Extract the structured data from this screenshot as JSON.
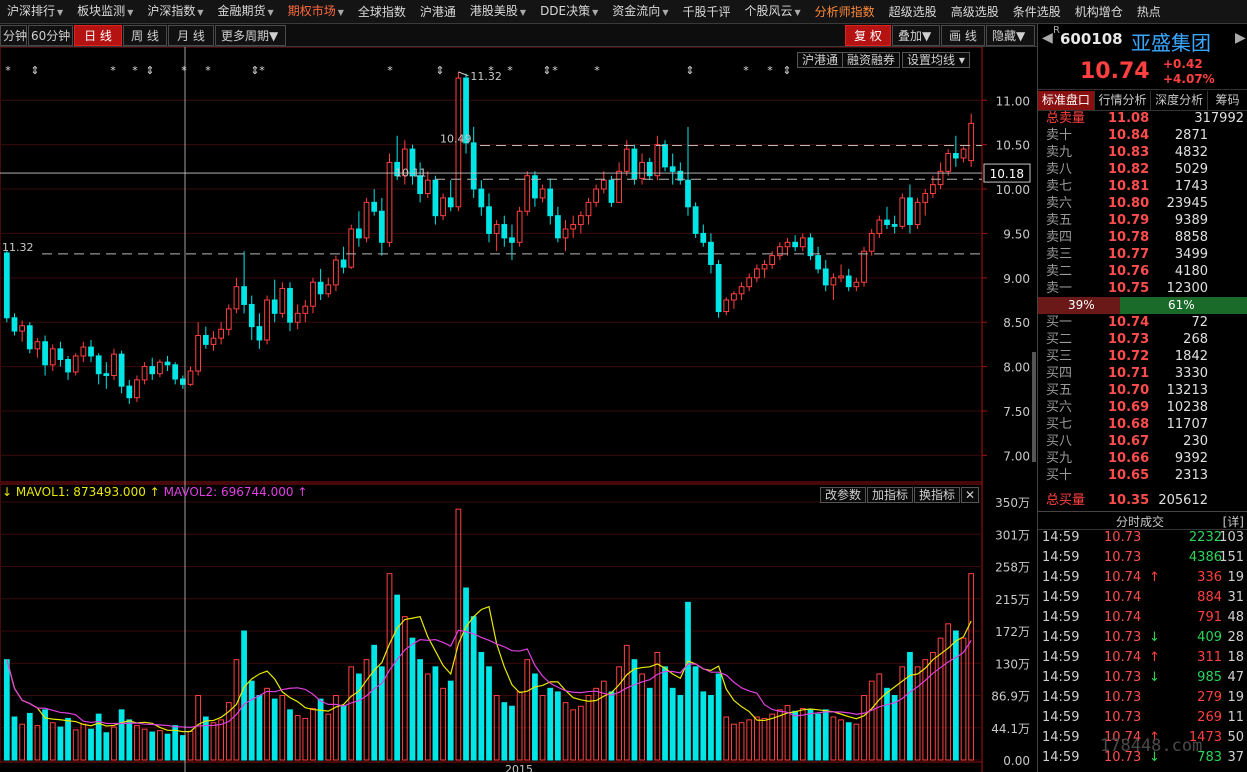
{
  "menu": [
    {
      "label": "沪深排行",
      "dd": true
    },
    {
      "label": "板块监测",
      "dd": true
    },
    {
      "label": "沪深指数",
      "dd": true
    },
    {
      "label": "金融期货",
      "dd": true
    },
    {
      "label": "期权市场",
      "dd": true,
      "active": true
    },
    {
      "label": "全球指数",
      "dd": false
    },
    {
      "label": "沪港通",
      "dd": false
    },
    {
      "label": "港股美股",
      "dd": true
    },
    {
      "label": "DDE决策",
      "dd": true
    },
    {
      "label": "资金流向",
      "dd": true
    },
    {
      "label": "千股千评",
      "dd": false
    },
    {
      "label": "个股风云",
      "dd": true
    },
    {
      "label": "分析师指数",
      "dd": false,
      "orange": true
    },
    {
      "label": "超级选股",
      "dd": false
    },
    {
      "label": "高级选股",
      "dd": false
    },
    {
      "label": "条件选股",
      "dd": false
    },
    {
      "label": "机构增仓",
      "dd": false
    },
    {
      "label": "热点",
      "dd": false
    }
  ],
  "toolbar": {
    "periods": [
      "分钟",
      "60分钟",
      "日 线",
      "周 线",
      "月 线"
    ],
    "more": "更多周期",
    "selected": "日 线",
    "restore": "复 权",
    "overlay": "叠加",
    "draw": "画 线",
    "hide": "隐藏"
  },
  "chart_buttons": {
    "hgt": "沪港通",
    "rzrq": "融资融券",
    "ma_settings": "设置均线"
  },
  "vol_buttons": {
    "change": "改参数",
    "add": "加指标",
    "swap": "换指标"
  },
  "legend": {
    "arrow": "↓",
    "mavol1": "MAVOL1: 873493.000",
    "mavol2": "MAVOL2: 696744.000",
    "up": "↑"
  },
  "colors": {
    "up": "#ff4040",
    "down": "#00e6e6",
    "ma1": "#e8e800",
    "ma2": "#e040e0",
    "text": "#c8c8c8",
    "grid": "#8c1010"
  },
  "price_ticks": [
    "11.00",
    "10.50",
    "10.00",
    "9.50",
    "9.00",
    "8.50",
    "8.00",
    "7.50",
    "7.00"
  ],
  "current_price_label": "10.18",
  "price_annotations": [
    "11.32",
    "10.49",
    "10.11",
    "9.27"
  ],
  "volume_ticks": [
    "350万",
    "301万",
    "258万",
    "215万",
    "172万",
    "130万",
    "86.9万",
    "44.1万",
    "0.00"
  ],
  "x_label": "2015",
  "chart_data": {
    "type": "candlestick",
    "xlabel": "2015",
    "ylim": [
      6.7,
      11.6
    ],
    "volume_ylim": [
      0,
      3600000
    ],
    "ma_volume": {
      "mavol1": 873493.0,
      "mavol2": 696744.0
    },
    "candles": [
      [
        9.28,
        9.3,
        8.5,
        8.55,
        1400000
      ],
      [
        8.55,
        8.6,
        8.35,
        8.4,
        600000
      ],
      [
        8.4,
        8.52,
        8.28,
        8.46,
        500000
      ],
      [
        8.46,
        8.5,
        8.15,
        8.2,
        650000
      ],
      [
        8.2,
        8.32,
        8.1,
        8.28,
        480000
      ],
      [
        8.28,
        8.35,
        7.9,
        8.02,
        700000
      ],
      [
        8.02,
        8.25,
        7.95,
        8.2,
        520000
      ],
      [
        8.2,
        8.28,
        8.0,
        8.08,
        460000
      ],
      [
        8.08,
        8.12,
        7.85,
        7.94,
        580000
      ],
      [
        7.94,
        8.15,
        7.9,
        8.12,
        420000
      ],
      [
        8.12,
        8.28,
        8.05,
        8.22,
        500000
      ],
      [
        8.22,
        8.3,
        8.05,
        8.12,
        430000
      ],
      [
        8.12,
        8.15,
        7.8,
        7.92,
        640000
      ],
      [
        7.92,
        8.05,
        7.75,
        7.9,
        380000
      ],
      [
        7.9,
        8.2,
        7.85,
        8.14,
        460000
      ],
      [
        8.14,
        8.18,
        7.7,
        7.78,
        700000
      ],
      [
        7.78,
        7.85,
        7.58,
        7.65,
        560000
      ],
      [
        7.65,
        7.9,
        7.6,
        7.85,
        480000
      ],
      [
        7.85,
        8.05,
        7.8,
        8.0,
        430000
      ],
      [
        8.0,
        8.1,
        7.85,
        7.92,
        390000
      ],
      [
        7.92,
        8.08,
        7.88,
        8.05,
        410000
      ],
      [
        8.05,
        8.12,
        7.95,
        8.02,
        360000
      ],
      [
        8.02,
        8.05,
        7.8,
        7.86,
        480000
      ],
      [
        7.86,
        7.9,
        7.75,
        7.8,
        340000
      ],
      [
        7.8,
        8.0,
        7.78,
        7.95,
        400000
      ],
      [
        7.95,
        8.5,
        7.9,
        8.35,
        900000
      ],
      [
        8.35,
        8.45,
        8.2,
        8.25,
        600000
      ],
      [
        8.25,
        8.4,
        8.18,
        8.32,
        520000
      ],
      [
        8.32,
        8.5,
        8.25,
        8.42,
        560000
      ],
      [
        8.42,
        8.7,
        8.35,
        8.65,
        800000
      ],
      [
        8.65,
        9.0,
        8.6,
        8.9,
        1400000
      ],
      [
        8.9,
        9.3,
        8.6,
        8.7,
        1800000
      ],
      [
        8.7,
        8.8,
        8.3,
        8.45,
        1100000
      ],
      [
        8.45,
        8.6,
        8.2,
        8.3,
        900000
      ],
      [
        8.3,
        8.8,
        8.25,
        8.75,
        1000000
      ],
      [
        8.75,
        8.98,
        8.5,
        8.6,
        850000
      ],
      [
        8.6,
        8.95,
        8.55,
        8.88,
        900000
      ],
      [
        8.88,
        8.95,
        8.4,
        8.5,
        700000
      ],
      [
        8.5,
        8.7,
        8.42,
        8.6,
        620000
      ],
      [
        8.6,
        8.75,
        8.5,
        8.68,
        580000
      ],
      [
        8.68,
        9.0,
        8.6,
        8.95,
        720000
      ],
      [
        8.95,
        9.1,
        8.75,
        8.82,
        850000
      ],
      [
        8.82,
        9.0,
        8.78,
        8.92,
        640000
      ],
      [
        8.92,
        9.25,
        8.85,
        9.2,
        900000
      ],
      [
        9.2,
        9.35,
        9.05,
        9.12,
        760000
      ],
      [
        9.12,
        9.6,
        9.1,
        9.55,
        1300000
      ],
      [
        9.55,
        9.75,
        9.35,
        9.45,
        1200000
      ],
      [
        9.45,
        9.9,
        9.4,
        9.85,
        1400000
      ],
      [
        9.85,
        10.0,
        9.7,
        9.75,
        1600000
      ],
      [
        9.75,
        9.9,
        9.25,
        9.4,
        1300000
      ],
      [
        9.4,
        10.4,
        9.35,
        10.3,
        2600000
      ],
      [
        10.3,
        10.6,
        10.1,
        10.15,
        2300000
      ],
      [
        10.15,
        10.55,
        10.05,
        10.45,
        2000000
      ],
      [
        10.45,
        10.5,
        10.05,
        10.15,
        1700000
      ],
      [
        10.15,
        10.3,
        9.85,
        9.95,
        1400000
      ],
      [
        9.95,
        10.2,
        9.9,
        10.1,
        1200000
      ],
      [
        10.1,
        10.15,
        9.6,
        9.7,
        1300000
      ],
      [
        9.7,
        9.95,
        9.65,
        9.9,
        1000000
      ],
      [
        9.9,
        10.1,
        9.75,
        9.8,
        1100000
      ],
      [
        9.8,
        11.32,
        9.75,
        11.25,
        3500000
      ],
      [
        11.25,
        11.3,
        10.4,
        10.52,
        2400000
      ],
      [
        10.52,
        10.7,
        9.9,
        10.0,
        2000000
      ],
      [
        10.0,
        10.1,
        9.7,
        9.8,
        1500000
      ],
      [
        9.8,
        9.95,
        9.4,
        9.5,
        1300000
      ],
      [
        9.5,
        9.65,
        9.3,
        9.6,
        900000
      ],
      [
        9.6,
        9.7,
        9.35,
        9.45,
        800000
      ],
      [
        9.45,
        9.6,
        9.2,
        9.4,
        750000
      ],
      [
        9.4,
        9.8,
        9.35,
        9.75,
        950000
      ],
      [
        9.75,
        10.2,
        9.7,
        10.15,
        1400000
      ],
      [
        10.15,
        10.2,
        9.8,
        9.9,
        1200000
      ],
      [
        9.9,
        10.05,
        9.85,
        10.0,
        900000
      ],
      [
        10.0,
        10.12,
        9.6,
        9.7,
        1000000
      ],
      [
        9.7,
        9.8,
        9.4,
        9.45,
        950000
      ],
      [
        9.45,
        9.65,
        9.3,
        9.55,
        800000
      ],
      [
        9.55,
        9.7,
        9.45,
        9.6,
        700000
      ],
      [
        9.6,
        9.75,
        9.5,
        9.7,
        750000
      ],
      [
        9.7,
        9.9,
        9.6,
        9.85,
        900000
      ],
      [
        9.85,
        10.05,
        9.8,
        10.0,
        1000000
      ],
      [
        10.0,
        10.2,
        9.95,
        10.1,
        1100000
      ],
      [
        10.1,
        10.15,
        9.8,
        9.85,
        950000
      ],
      [
        9.85,
        10.3,
        9.85,
        10.2,
        1300000
      ],
      [
        10.2,
        10.55,
        10.15,
        10.45,
        1600000
      ],
      [
        10.45,
        10.5,
        10.05,
        10.12,
        1400000
      ],
      [
        10.12,
        10.4,
        10.05,
        10.3,
        1200000
      ],
      [
        10.3,
        10.35,
        10.1,
        10.15,
        1000000
      ],
      [
        10.15,
        10.6,
        10.1,
        10.5,
        1500000
      ],
      [
        10.5,
        10.55,
        10.2,
        10.25,
        1300000
      ],
      [
        10.25,
        10.4,
        10.05,
        10.2,
        1000000
      ],
      [
        10.2,
        10.3,
        10.05,
        10.1,
        900000
      ],
      [
        10.1,
        10.7,
        9.7,
        9.8,
        2200000
      ],
      [
        9.8,
        9.85,
        9.45,
        9.5,
        1300000
      ],
      [
        9.5,
        9.6,
        9.35,
        9.4,
        950000
      ],
      [
        9.4,
        9.5,
        9.05,
        9.15,
        900000
      ],
      [
        9.15,
        9.2,
        8.55,
        8.62,
        1200000
      ],
      [
        8.62,
        8.78,
        8.58,
        8.75,
        600000
      ],
      [
        8.75,
        8.85,
        8.65,
        8.82,
        500000
      ],
      [
        8.82,
        8.95,
        8.75,
        8.9,
        520000
      ],
      [
        8.9,
        9.05,
        8.85,
        9.0,
        560000
      ],
      [
        9.0,
        9.15,
        8.95,
        9.1,
        600000
      ],
      [
        9.1,
        9.2,
        9.0,
        9.15,
        580000
      ],
      [
        9.15,
        9.3,
        9.1,
        9.25,
        640000
      ],
      [
        9.25,
        9.4,
        9.2,
        9.35,
        700000
      ],
      [
        9.35,
        9.45,
        9.25,
        9.4,
        760000
      ],
      [
        9.4,
        9.48,
        9.3,
        9.35,
        680000
      ],
      [
        9.35,
        9.5,
        9.3,
        9.45,
        720000
      ],
      [
        9.45,
        9.5,
        9.2,
        9.25,
        700000
      ],
      [
        9.25,
        9.35,
        9.05,
        9.1,
        640000
      ],
      [
        9.1,
        9.2,
        8.85,
        8.92,
        700000
      ],
      [
        8.92,
        9.05,
        8.75,
        9.0,
        600000
      ],
      [
        9.0,
        9.15,
        8.95,
        9.02,
        560000
      ],
      [
        9.02,
        9.1,
        8.85,
        8.9,
        520000
      ],
      [
        8.9,
        9.0,
        8.85,
        8.95,
        500000
      ],
      [
        8.95,
        9.35,
        8.9,
        9.3,
        900000
      ],
      [
        9.3,
        9.55,
        9.25,
        9.5,
        1100000
      ],
      [
        9.5,
        9.7,
        9.45,
        9.65,
        1200000
      ],
      [
        9.65,
        9.8,
        9.55,
        9.6,
        1000000
      ],
      [
        9.6,
        9.7,
        9.5,
        9.58,
        900000
      ],
      [
        9.58,
        9.95,
        9.55,
        9.9,
        1300000
      ],
      [
        9.9,
        10.05,
        9.5,
        9.6,
        1500000
      ],
      [
        9.6,
        9.9,
        9.55,
        9.85,
        1300000
      ],
      [
        9.85,
        10.0,
        9.7,
        9.95,
        1400000
      ],
      [
        9.95,
        10.15,
        9.9,
        10.05,
        1500000
      ],
      [
        10.05,
        10.3,
        10.0,
        10.2,
        1700000
      ],
      [
        10.2,
        10.45,
        10.15,
        10.4,
        1900000
      ],
      [
        10.4,
        10.6,
        10.25,
        10.35,
        1800000
      ],
      [
        10.35,
        10.48,
        10.3,
        10.45,
        1700000
      ],
      [
        10.32,
        10.85,
        10.25,
        10.74,
        2600000
      ]
    ]
  },
  "quote": {
    "r_mark": "R",
    "code": "600108",
    "name": "亚盛集团",
    "price": "10.74",
    "change": "+0.42",
    "change_pct": "+4.07%"
  },
  "panel_tabs": [
    "标准盘口",
    "行情分析",
    "深度分析",
    "筹码"
  ],
  "total_sell": {
    "label": "总卖量",
    "price": "11.08",
    "vol": "317992"
  },
  "asks": [
    {
      "label": "卖十",
      "price": "10.84",
      "vol": "2871"
    },
    {
      "label": "卖九",
      "price": "10.83",
      "vol": "4832"
    },
    {
      "label": "卖八",
      "price": "10.82",
      "vol": "5029"
    },
    {
      "label": "卖七",
      "price": "10.81",
      "vol": "1743"
    },
    {
      "label": "卖六",
      "price": "10.80",
      "vol": "23945"
    },
    {
      "label": "卖五",
      "price": "10.79",
      "vol": "9389"
    },
    {
      "label": "卖四",
      "price": "10.78",
      "vol": "8858"
    },
    {
      "label": "卖三",
      "price": "10.77",
      "vol": "3499"
    },
    {
      "label": "卖二",
      "price": "10.76",
      "vol": "4180"
    },
    {
      "label": "卖一",
      "price": "10.75",
      "vol": "12300"
    }
  ],
  "ratio": {
    "sell_pct": "39%",
    "buy_pct": "61%",
    "sell_value": 0.39
  },
  "bids": [
    {
      "label": "买一",
      "price": "10.74",
      "vol": "72"
    },
    {
      "label": "买二",
      "price": "10.73",
      "vol": "268"
    },
    {
      "label": "买三",
      "price": "10.72",
      "vol": "1842"
    },
    {
      "label": "买四",
      "price": "10.71",
      "vol": "3330"
    },
    {
      "label": "买五",
      "price": "10.70",
      "vol": "13213"
    },
    {
      "label": "买六",
      "price": "10.69",
      "vol": "10238"
    },
    {
      "label": "买七",
      "price": "10.68",
      "vol": "11707"
    },
    {
      "label": "买八",
      "price": "10.67",
      "vol": "230"
    },
    {
      "label": "买九",
      "price": "10.66",
      "vol": "9392"
    },
    {
      "label": "买十",
      "price": "10.65",
      "vol": "2313"
    }
  ],
  "total_buy": {
    "label": "总买量",
    "price": "10.35",
    "vol": "205612"
  },
  "ticks_header": {
    "title": "分时成交",
    "detail": "[详]"
  },
  "ticks": [
    {
      "time": "14:59",
      "price": "10.73",
      "arrow": "",
      "vol": "2232",
      "count": "103",
      "dir": "down"
    },
    {
      "time": "14:59",
      "price": "10.73",
      "arrow": "",
      "vol": "4386",
      "count": "151",
      "dir": "down"
    },
    {
      "time": "14:59",
      "price": "10.74",
      "arrow": "↑",
      "vol": "336",
      "count": "19",
      "dir": "up"
    },
    {
      "time": "14:59",
      "price": "10.74",
      "arrow": "",
      "vol": "884",
      "count": "31",
      "dir": "up"
    },
    {
      "time": "14:59",
      "price": "10.74",
      "arrow": "",
      "vol": "791",
      "count": "48",
      "dir": "up"
    },
    {
      "time": "14:59",
      "price": "10.73",
      "arrow": "↓",
      "vol": "409",
      "count": "28",
      "dir": "down"
    },
    {
      "time": "14:59",
      "price": "10.74",
      "arrow": "↑",
      "vol": "311",
      "count": "18",
      "dir": "up"
    },
    {
      "time": "14:59",
      "price": "10.73",
      "arrow": "↓",
      "vol": "985",
      "count": "47",
      "dir": "down"
    },
    {
      "time": "14:59",
      "price": "10.73",
      "arrow": "",
      "vol": "279",
      "count": "19",
      "dir": "up"
    },
    {
      "time": "14:59",
      "price": "10.73",
      "arrow": "",
      "vol": "269",
      "count": "11",
      "dir": "up"
    },
    {
      "time": "14:59",
      "price": "10.74",
      "arrow": "↑",
      "vol": "1473",
      "count": "50",
      "dir": "up"
    },
    {
      "time": "14:59",
      "price": "10.73",
      "arrow": "↓",
      "vol": "783",
      "count": "37",
      "dir": "down"
    }
  ],
  "watermark": "178448.com"
}
